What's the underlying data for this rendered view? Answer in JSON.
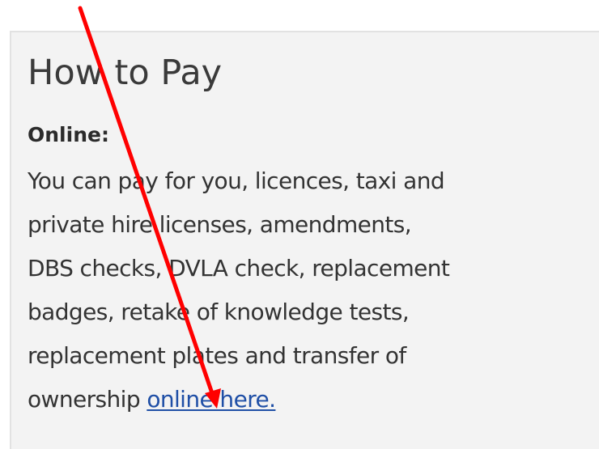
{
  "section": {
    "heading": "How to Pay",
    "subheading": "Online:",
    "lines": [
      "You can pay for you, licences,  taxi and",
      "private hire licenses, amendments,",
      "DBS checks, DVLA check, replacement",
      "badges, retake of knowledge tests,",
      "replacement plates and transfer of"
    ],
    "last_line_prefix": "ownership ",
    "link_text": "online here."
  },
  "annotation": {
    "type": "arrow",
    "color": "#ff0000"
  },
  "colors": {
    "panel_background": "#f3f3f3",
    "link": "#1f4fa6",
    "text": "#333333"
  }
}
